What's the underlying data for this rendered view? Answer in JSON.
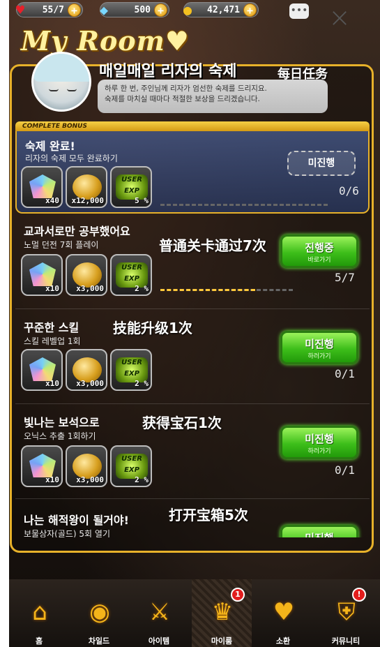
{
  "status_bar": {
    "hearts": "55/7",
    "gems": "500",
    "gold": "42,471"
  },
  "title": "My Room",
  "character": {
    "name": "매일매일 리자의 숙제",
    "annotation": "每日任务",
    "speech": "하루 한 번, 주인님께 리자가 엄선한 숙제를 드리지요.\n숙제를 마치실 때마다 적절한 보상을 드리겠습니다."
  },
  "complete_bonus_label": "COMPLETE BONUS",
  "missions": [
    {
      "title": "숙제 완료!",
      "subtitle": "리자의 숙제 모두 완료하기",
      "rewards": [
        "x40",
        "x12,000",
        "5 %"
      ],
      "button": "미진행",
      "progress": "0/6",
      "fill": 0
    },
    {
      "title": "교과서로만 공부했어요",
      "subtitle": "노멀 던전 7회 플레이",
      "annotation": "普通关卡通过7次",
      "rewards": [
        "x10",
        "x3,000",
        "2 %"
      ],
      "button": "진행중",
      "button_sub": "바로가기",
      "progress": "5/7",
      "fill": 0.714
    },
    {
      "title": "꾸준한 스킬",
      "subtitle": "스킬 레벨업 1회",
      "annotation": "技能升级1次",
      "rewards": [
        "x10",
        "x3,000",
        "2 %"
      ],
      "button": "미진행",
      "button_sub": "하러가기",
      "progress": "0/1",
      "fill": 0
    },
    {
      "title": "빛나는 보석으로",
      "subtitle": "오닉스 추출 1회하기",
      "annotation": "获得宝石1次",
      "rewards": [
        "x10",
        "x3,000",
        "2 %"
      ],
      "button": "미진행",
      "button_sub": "하러가기",
      "progress": "0/1",
      "fill": 0
    },
    {
      "title": "나는 해적왕이 될거야!",
      "subtitle": "보물상자(골드) 5회 열기",
      "annotation": "打开宝箱5次",
      "button": "미진행"
    }
  ],
  "nav": [
    {
      "label": "홈",
      "icon": "home-icon"
    },
    {
      "label": "차일드",
      "icon": "child-icon"
    },
    {
      "label": "아이템",
      "icon": "item-icon"
    },
    {
      "label": "마이룸",
      "icon": "myroom-icon",
      "badge": "1"
    },
    {
      "label": "소환",
      "icon": "summon-icon"
    },
    {
      "label": "커뮤니티",
      "icon": "community-icon",
      "badge": "!"
    }
  ],
  "colors": {
    "accent": "#e7b12a",
    "button_green": "#3dbe1a",
    "badge_red": "#e21d1d"
  }
}
